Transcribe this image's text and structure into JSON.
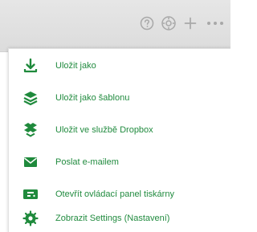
{
  "colors": {
    "accent": "#1f8a3c",
    "toolbar_bg": "#e1e1e1",
    "toolbar_icon": "#a8a8a8"
  },
  "toolbar": {
    "icons": [
      "help-icon",
      "settings-icon",
      "add-icon",
      "more-icon"
    ]
  },
  "menu": {
    "items": [
      {
        "label": "Uložit jako",
        "icon": "download-icon"
      },
      {
        "label": "Uložit jako šablonu",
        "icon": "layers-icon"
      },
      {
        "label": "Uložit ve službě Dropbox",
        "icon": "dropbox-icon"
      },
      {
        "label": "Poslat e-mailem",
        "icon": "mail-icon"
      },
      {
        "label": "Otevřít ovládací panel tiskárny",
        "icon": "printer-panel-icon"
      },
      {
        "label": "Zobrazit Settings (Nastavení)",
        "icon": "gear-icon"
      }
    ]
  }
}
